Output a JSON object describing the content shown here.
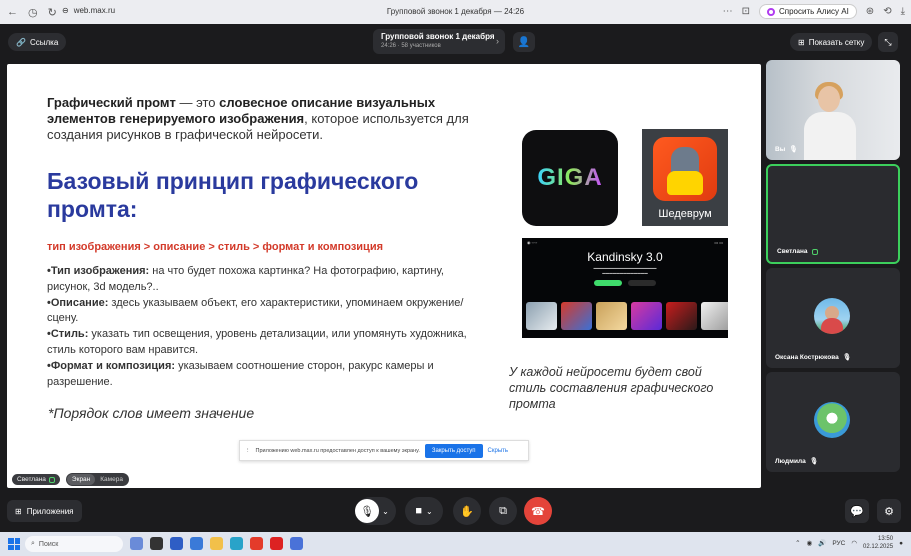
{
  "browser": {
    "url": "web.max.ru",
    "tab_title": "Групповой звонок 1 декабря — 24:26",
    "alice_label": "Спросить Алису AI"
  },
  "header": {
    "link_label": "Ссылка",
    "call_title": "Групповой звонок 1 декабря",
    "call_subtitle": "24:26 · 58 участников",
    "grid_label": "Показать сетку"
  },
  "slide": {
    "intro_term": "Графический промт",
    "intro_dash": " — это ",
    "intro_bold": "словесное описание визуальных элементов генерируемого изображения",
    "intro_rest": ", которое используется для создания рисунков в графической нейросети.",
    "heading": "Базовый принцип графического промта:",
    "formula": "тип изображения > описание > стиль > формат и композиция",
    "bullets": [
      {
        "label": "•Тип изображения:",
        "text": " на что будет похожа картинка? На фотографию, картину, рисунок, 3d модель?.."
      },
      {
        "label": "•Описание:",
        "text": " здесь указываем объект, его характеристики, упоминаем окружение/сцену."
      },
      {
        "label": "•Стиль:",
        "text": " указать тип освещения, уровень детализации, или упомянуть художника, стиль которого вам нравится."
      },
      {
        "label": "•Формат и композиция:",
        "text": " указываем соотношение сторон, ракурс камеры и разрешение."
      }
    ],
    "order_note": "*Порядок слов имеет значение",
    "caption": "У каждой нейросети будет свой стиль составления графического промта",
    "giga_label": "GIGA",
    "shedevrum_label": "Шедеврум",
    "kandinsky_title": "Kandinsky 3.0"
  },
  "share_notice": {
    "text": "Приложению web.max.ru предоставлен доступ к вашему экрану.",
    "close_label": "Закрыть доступ",
    "hide_label": "Скрыть"
  },
  "stage_pills": {
    "speaker": "Светлана",
    "screen": "Экран",
    "camera": "Камера"
  },
  "participants": [
    {
      "name": "Вы"
    },
    {
      "name": "Светлана"
    },
    {
      "name": "Оксана Кострюкова"
    },
    {
      "name": "Людмила"
    }
  ],
  "controls": {
    "apps_label": "Приложения"
  },
  "taskbar": {
    "search_placeholder": "Поиск",
    "lang": "РУС",
    "time": "13:50",
    "date": "02.12.2025"
  },
  "colors": {
    "accent_blue": "#2a3a9e",
    "formula_red": "#d33a2a",
    "end_call": "#e4443a",
    "speaking_green": "#3ccf5c"
  }
}
